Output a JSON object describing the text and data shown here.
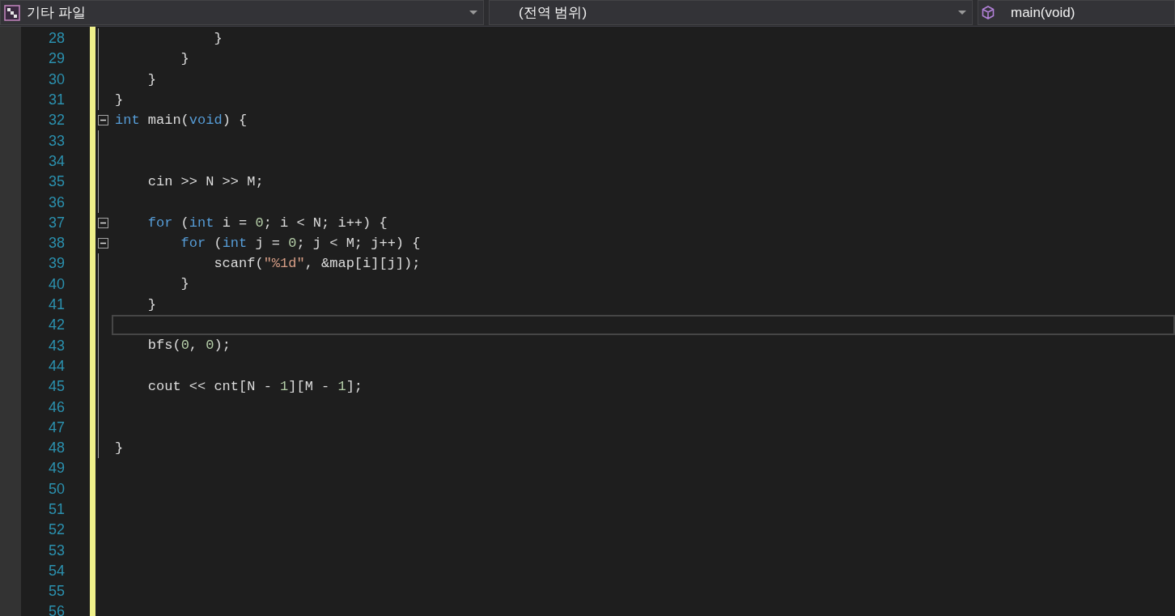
{
  "navigation_bar": [
    {
      "kind": "project",
      "text": "기타 파일",
      "caret": true
    },
    {
      "kind": "scope",
      "text": "(전역 범위)",
      "caret": true
    },
    {
      "kind": "member",
      "text": "main(void)",
      "caret": false
    }
  ],
  "editor": {
    "lines": [
      {
        "number": "28",
        "foldable": false,
        "in_block": true,
        "current": false,
        "tokens": [
          {
            "kind": "plain",
            "text": "            }"
          }
        ]
      },
      {
        "number": "29",
        "foldable": false,
        "in_block": true,
        "current": false,
        "tokens": [
          {
            "kind": "plain",
            "text": "        }"
          }
        ]
      },
      {
        "number": "30",
        "foldable": false,
        "in_block": true,
        "current": false,
        "tokens": [
          {
            "kind": "plain",
            "text": "    }"
          }
        ]
      },
      {
        "number": "31",
        "foldable": false,
        "in_block": true,
        "current": false,
        "tokens": [
          {
            "kind": "plain",
            "text": "}"
          }
        ]
      },
      {
        "number": "32",
        "foldable": true,
        "in_block": false,
        "current": false,
        "tokens": [
          {
            "kind": "keyword",
            "text": "int"
          },
          {
            "kind": "plain",
            "text": " main("
          },
          {
            "kind": "keyword",
            "text": "void"
          },
          {
            "kind": "plain",
            "text": ") {"
          }
        ]
      },
      {
        "number": "33",
        "foldable": false,
        "in_block": true,
        "current": false
      },
      {
        "number": "34",
        "foldable": false,
        "in_block": true,
        "current": false
      },
      {
        "number": "35",
        "foldable": false,
        "in_block": true,
        "current": false,
        "tokens": [
          {
            "kind": "plain",
            "text": "    cin >> N >> M;"
          }
        ]
      },
      {
        "number": "36",
        "foldable": false,
        "in_block": true,
        "current": false
      },
      {
        "number": "37",
        "foldable": true,
        "in_block": false,
        "current": false,
        "tokens": [
          {
            "kind": "keyword",
            "text": "    for"
          },
          {
            "kind": "plain",
            "text": " ("
          },
          {
            "kind": "keyword",
            "text": "int"
          },
          {
            "kind": "plain",
            "text": " i = "
          },
          {
            "kind": "number",
            "text": "0"
          },
          {
            "kind": "plain",
            "text": "; i < N; i++) {"
          }
        ]
      },
      {
        "number": "38",
        "foldable": true,
        "in_block": false,
        "current": false,
        "tokens": [
          {
            "kind": "keyword",
            "text": "        for"
          },
          {
            "kind": "plain",
            "text": " ("
          },
          {
            "kind": "keyword",
            "text": "int"
          },
          {
            "kind": "plain",
            "text": " j = "
          },
          {
            "kind": "number",
            "text": "0"
          },
          {
            "kind": "plain",
            "text": "; j < M; j++) {"
          }
        ]
      },
      {
        "number": "39",
        "foldable": false,
        "in_block": true,
        "current": false,
        "tokens": [
          {
            "kind": "plain",
            "text": "            scanf("
          },
          {
            "kind": "string",
            "text": "\"%1d\""
          },
          {
            "kind": "plain",
            "text": ", &map[i][j]);"
          }
        ]
      },
      {
        "number": "40",
        "foldable": false,
        "in_block": true,
        "current": false,
        "tokens": [
          {
            "kind": "plain",
            "text": "        }"
          }
        ]
      },
      {
        "number": "41",
        "foldable": false,
        "in_block": true,
        "current": false,
        "tokens": [
          {
            "kind": "plain",
            "text": "    }"
          }
        ]
      },
      {
        "number": "42",
        "foldable": false,
        "in_block": true,
        "current": true
      },
      {
        "number": "43",
        "foldable": false,
        "in_block": true,
        "current": false,
        "tokens": [
          {
            "kind": "plain",
            "text": "    bfs("
          },
          {
            "kind": "number",
            "text": "0"
          },
          {
            "kind": "plain",
            "text": ", "
          },
          {
            "kind": "number",
            "text": "0"
          },
          {
            "kind": "plain",
            "text": ");"
          }
        ]
      },
      {
        "number": "44",
        "foldable": false,
        "in_block": true,
        "current": false
      },
      {
        "number": "45",
        "foldable": false,
        "in_block": true,
        "current": false,
        "tokens": [
          {
            "kind": "plain",
            "text": "    cout << cnt[N - "
          },
          {
            "kind": "number",
            "text": "1"
          },
          {
            "kind": "plain",
            "text": "][M - "
          },
          {
            "kind": "number",
            "text": "1"
          },
          {
            "kind": "plain",
            "text": "];"
          }
        ]
      },
      {
        "number": "46",
        "foldable": false,
        "in_block": true,
        "current": false
      },
      {
        "number": "47",
        "foldable": false,
        "in_block": true,
        "current": false
      },
      {
        "number": "48",
        "foldable": false,
        "in_block": true,
        "current": false,
        "tokens": [
          {
            "kind": "plain",
            "text": "}"
          }
        ]
      },
      {
        "number": "49",
        "foldable": false,
        "in_block": false,
        "current": false
      },
      {
        "number": "50",
        "foldable": false,
        "in_block": false,
        "current": false
      },
      {
        "number": "51",
        "foldable": false,
        "in_block": false,
        "current": false
      },
      {
        "number": "52",
        "foldable": false,
        "in_block": false,
        "current": false
      },
      {
        "number": "53",
        "foldable": false,
        "in_block": false,
        "current": false
      },
      {
        "number": "54",
        "foldable": false,
        "in_block": false,
        "current": false
      },
      {
        "number": "55",
        "foldable": false,
        "in_block": false,
        "current": false
      },
      {
        "number": "56",
        "foldable": false,
        "in_block": false,
        "current": false
      }
    ]
  }
}
